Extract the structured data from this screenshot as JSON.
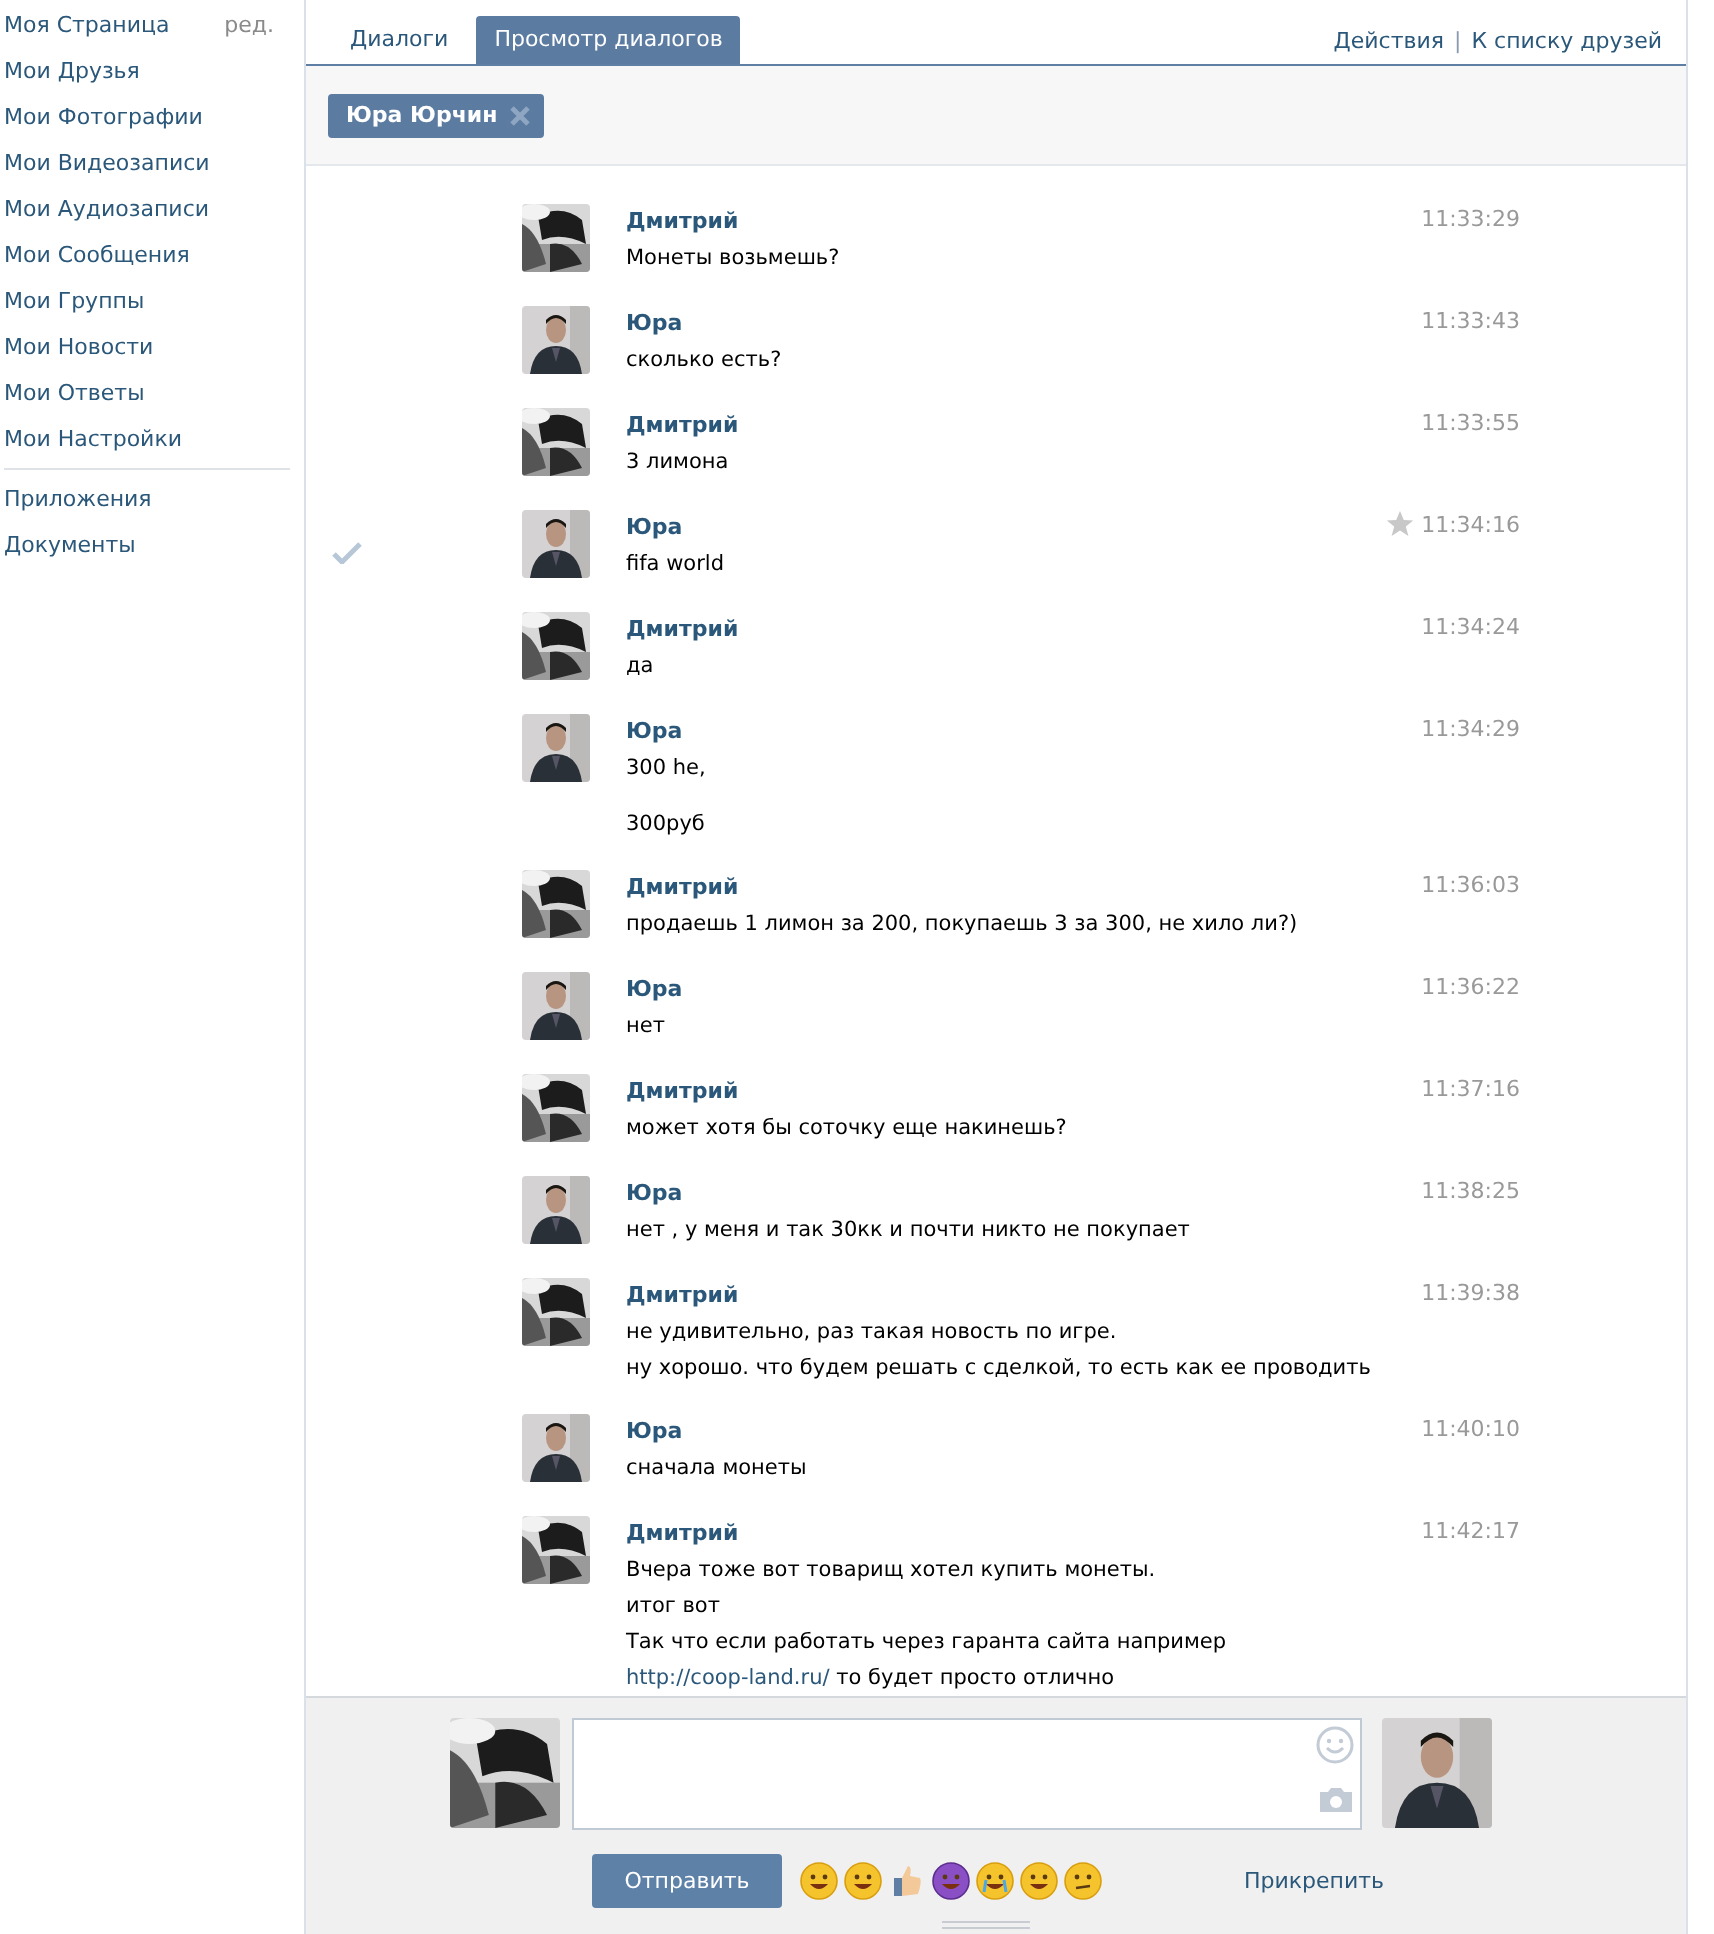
{
  "sidebar": {
    "items": [
      {
        "label": "Моя Страница",
        "edit": "ред."
      },
      {
        "label": "Мои Друзья"
      },
      {
        "label": "Мои Фотографии"
      },
      {
        "label": "Мои Видеозаписи"
      },
      {
        "label": "Мои Аудиозаписи"
      },
      {
        "label": "Мои Сообщения"
      },
      {
        "label": "Мои Группы"
      },
      {
        "label": "Мои Новости"
      },
      {
        "label": "Мои Ответы"
      },
      {
        "label": "Мои Настройки"
      }
    ],
    "extra_items": [
      {
        "label": "Приложения"
      },
      {
        "label": "Документы"
      }
    ]
  },
  "tabs": [
    {
      "label": "Диалоги",
      "selected": false
    },
    {
      "label": "Просмотр диалогов",
      "selected": true
    }
  ],
  "actions": [
    "Действия",
    "К списку друзей"
  ],
  "actions_separator": "|",
  "filter_chip": "Юра Юрчин",
  "messages": [
    {
      "sender": "Дмитрий",
      "outgoing": true,
      "time": "11:33:29",
      "selected": false,
      "paragraphs": [
        [
          "Монеты возьмешь?"
        ]
      ]
    },
    {
      "sender": "Юра",
      "outgoing": false,
      "time": "11:33:43",
      "selected": false,
      "paragraphs": [
        [
          "сколько есть?"
        ]
      ]
    },
    {
      "sender": "Дмитрий",
      "outgoing": true,
      "time": "11:33:55",
      "selected": false,
      "paragraphs": [
        [
          "3 лимона"
        ]
      ]
    },
    {
      "sender": "Юра",
      "outgoing": false,
      "time": "11:34:16",
      "selected": true,
      "paragraphs": [
        [
          "fifa world"
        ]
      ]
    },
    {
      "sender": "Дмитрий",
      "outgoing": true,
      "time": "11:34:24",
      "selected": false,
      "paragraphs": [
        [
          "да"
        ]
      ]
    },
    {
      "sender": "Юра",
      "outgoing": false,
      "time": "11:34:29",
      "selected": false,
      "paragraphs": [
        [
          "300 he,"
        ],
        [
          "300руб"
        ]
      ]
    },
    {
      "sender": "Дмитрий",
      "outgoing": true,
      "time": "11:36:03",
      "selected": false,
      "paragraphs": [
        [
          "продаешь 1 лимон за 200, покупаешь 3 за 300, не хило ли?)"
        ]
      ]
    },
    {
      "sender": "Юра",
      "outgoing": false,
      "time": "11:36:22",
      "selected": false,
      "paragraphs": [
        [
          "нет"
        ]
      ]
    },
    {
      "sender": "Дмитрий",
      "outgoing": true,
      "time": "11:37:16",
      "selected": false,
      "paragraphs": [
        [
          "может хотя бы соточку еще накинешь?"
        ]
      ]
    },
    {
      "sender": "Юра",
      "outgoing": false,
      "time": "11:38:25",
      "selected": false,
      "paragraphs": [
        [
          "нет , у меня и так 30кк и почти никто не покупает"
        ]
      ]
    },
    {
      "sender": "Дмитрий",
      "outgoing": true,
      "time": "11:39:38",
      "selected": false,
      "paragraphs": [
        [
          "не удивительно, раз такая новость по игре.",
          "ну хорошо. что будем решать с сделкой, то есть как ее проводить"
        ]
      ]
    },
    {
      "sender": "Юра",
      "outgoing": false,
      "time": "11:40:10",
      "selected": false,
      "paragraphs": [
        [
          "сначала монеты"
        ]
      ]
    },
    {
      "sender": "Дмитрий",
      "outgoing": true,
      "time": "11:42:17",
      "selected": false,
      "paragraphs": [
        [
          "Вчера тоже вот товарищ хотел купить монеты.",
          "итог вот",
          {
            "before": "Так что если работать через гаранта сайта например ",
            "link": "http://coop-land.ru/",
            "after": " то будет просто отлично"
          }
        ]
      ]
    }
  ],
  "composer": {
    "send": "Отправить",
    "attach": "Прикрепить"
  }
}
